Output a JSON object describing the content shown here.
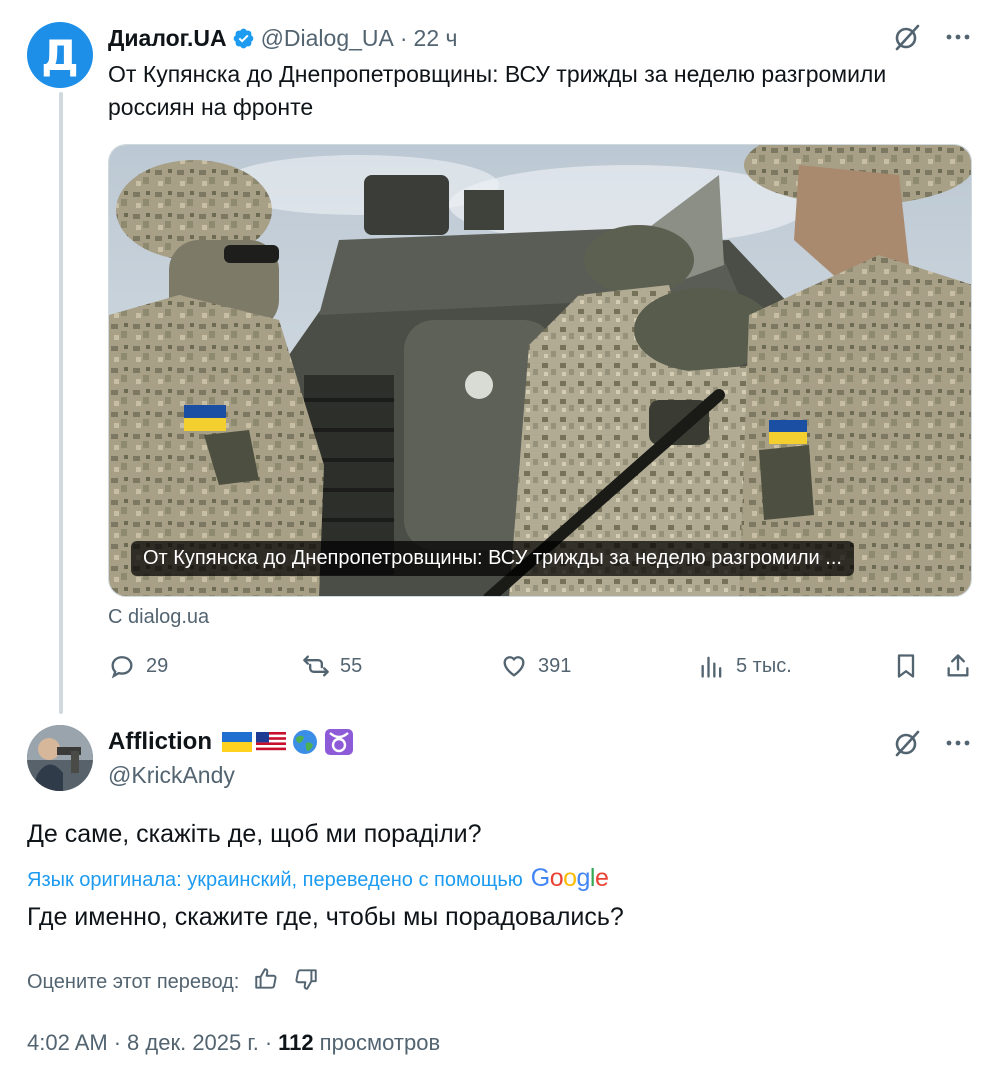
{
  "parent_tweet": {
    "avatar_letter": "Д",
    "name": "Диалог.UA",
    "handle": "@Dialog_UA",
    "separator": "·",
    "time": "22 ч",
    "text": "От Купянска до Днепропетровщины: ВСУ трижды за неделю разгромили россиян на фронте",
    "media_caption": "От Купянска до Днепропетровщины: ВСУ трижды за неделю разгромили ...",
    "source": "С dialog.ua",
    "stats": {
      "replies": "29",
      "reposts": "55",
      "likes": "391",
      "views": "5 тыс."
    }
  },
  "reply_tweet": {
    "name": "Affliction",
    "handle": "@KrickAndy",
    "name_emojis": [
      "ukraine-flag",
      "us-flag",
      "globe",
      "taurus"
    ],
    "text": "Де саме, скажіть де, щоб ми пораділи?",
    "translation_note": "Язык оригинала: украинский, переведено с помощью",
    "translation_provider": "Google",
    "translated_text": "Где именно, скажите где, чтобы мы порадовались?",
    "rate_prompt": "Оцените этот перевод:",
    "time": "4:02 AM",
    "dot1": "·",
    "date": "8 дек. 2025 г.",
    "dot2": "·",
    "views_count": "112",
    "views_label": "просмотров"
  },
  "colors": {
    "accent": "#1d9bf0",
    "secondary_text": "#536471",
    "primary_text": "#0f1419",
    "brand_avatar": "#1d8fe8"
  }
}
